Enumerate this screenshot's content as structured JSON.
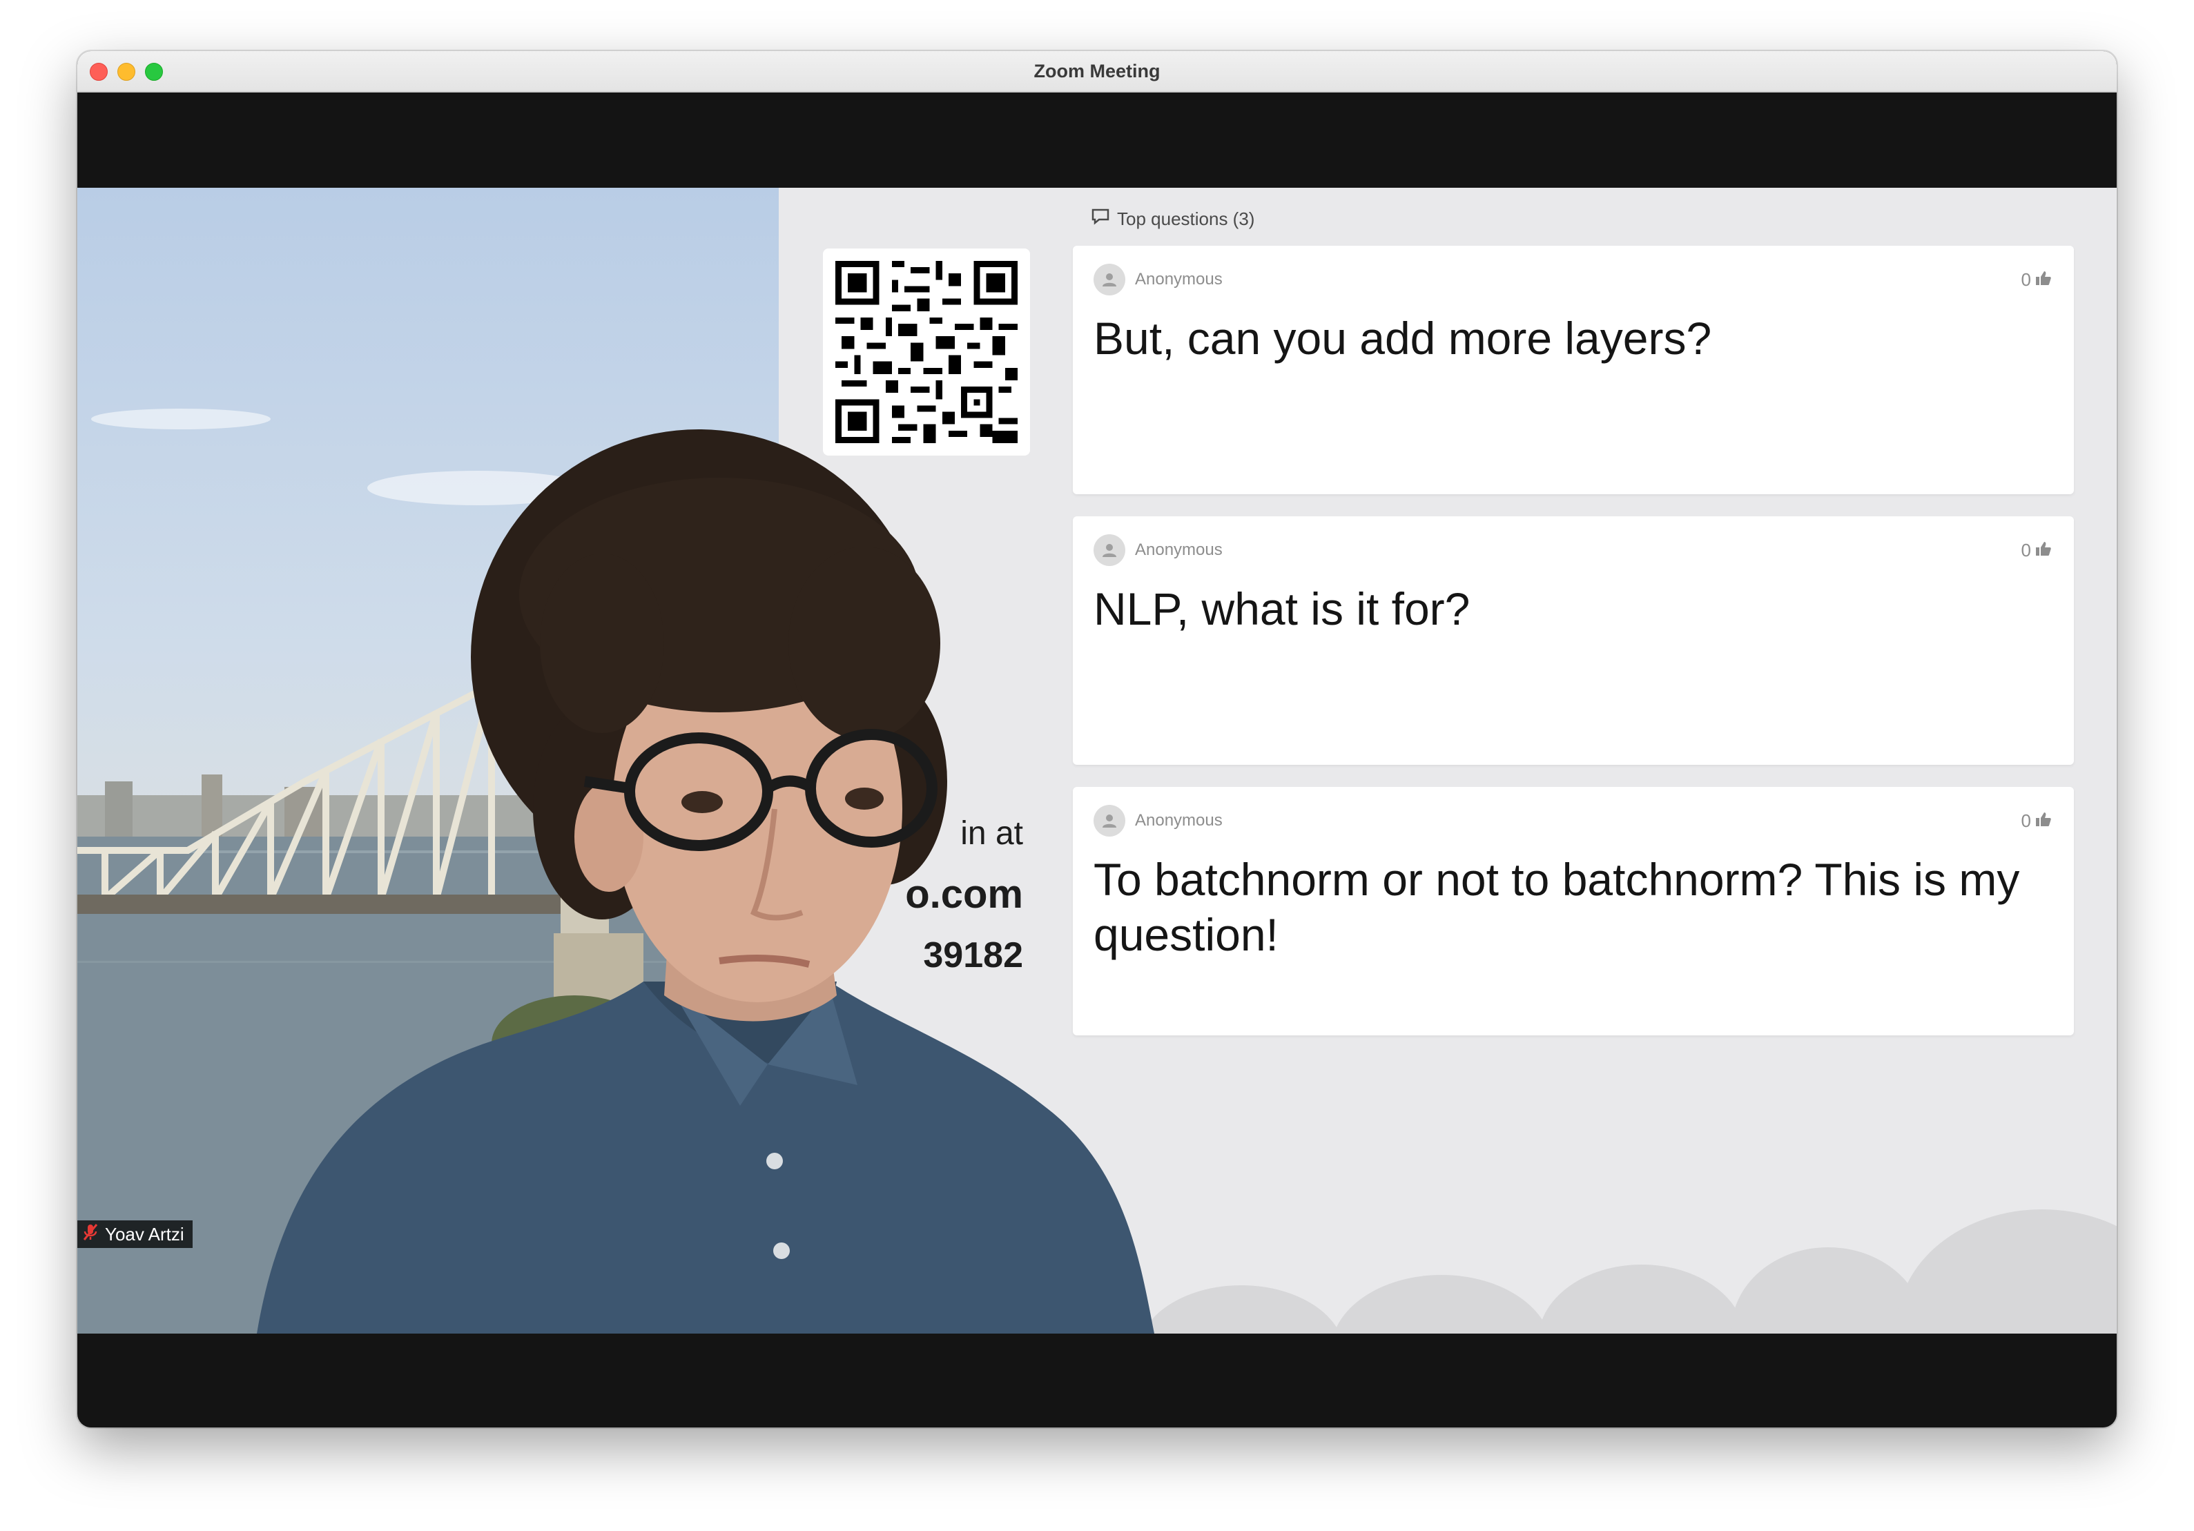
{
  "window": {
    "title": "Zoom Meeting"
  },
  "slido": {
    "top_questions_label": "Top questions (3)",
    "join_lines": [
      "in at",
      "o.com",
      "39182"
    ],
    "questions": [
      {
        "author": "Anonymous",
        "likes": "0",
        "text": "But, can you add more layers?"
      },
      {
        "author": "Anonymous",
        "likes": "0",
        "text": "NLP, what is it for?"
      },
      {
        "author": "Anonymous",
        "likes": "0",
        "text": "To batchnorm or not to batchnorm? This is my question!"
      }
    ]
  },
  "participant": {
    "name": "Yoav Artzi",
    "muted": true
  },
  "icons": {
    "top_questions": "speech-bubble-icon",
    "avatar": "user-icon",
    "like": "thumbs-up-icon",
    "mic": "mic-muted-icon"
  },
  "colors": {
    "close": "#fe5f57",
    "minimize": "#febc2e",
    "maximize": "#28c840",
    "muted_mic": "#e53935",
    "shirt": "#3d5670"
  }
}
